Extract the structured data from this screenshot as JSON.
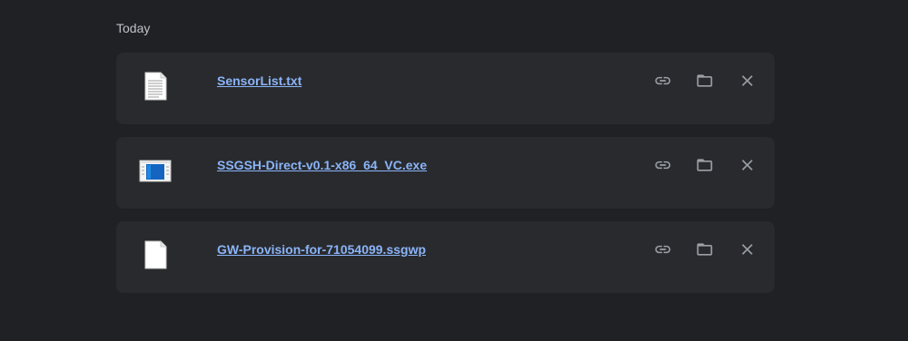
{
  "section": {
    "title": "Today"
  },
  "downloads": [
    {
      "file_name": "SensorList.txt",
      "icon": "text-file-icon",
      "actions": [
        "copy-link-icon",
        "show-in-folder-icon",
        "remove-icon"
      ]
    },
    {
      "file_name": "SSGSH-Direct-v0.1-x86_64_VC.exe",
      "icon": "executable-file-icon",
      "actions": [
        "copy-link-icon",
        "show-in-folder-icon",
        "remove-icon"
      ]
    },
    {
      "file_name": "GW-Provision-for-71054099.ssgwp",
      "icon": "generic-file-icon",
      "actions": [
        "copy-link-icon",
        "show-in-folder-icon",
        "remove-icon"
      ]
    }
  ],
  "colors": {
    "background": "#202124",
    "card": "#292a2d",
    "link": "#8ab4f8",
    "icon": "#9aa0a6"
  }
}
